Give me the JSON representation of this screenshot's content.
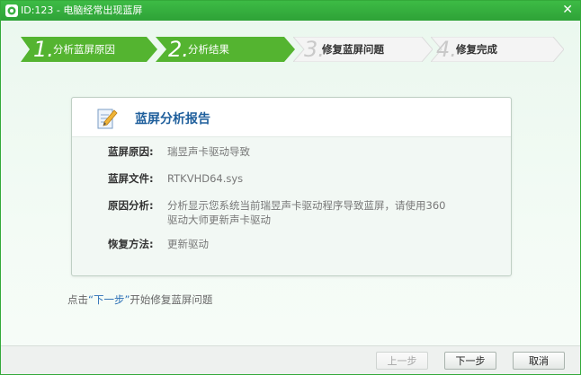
{
  "window": {
    "title": "ID:123 - 电脑经常出现蓝屏",
    "close_glyph": "✕",
    "icon": "app-logo-icon"
  },
  "steps": [
    {
      "num": "1.",
      "label": "分析蓝屏原因",
      "state": "active"
    },
    {
      "num": "2.",
      "label": "分析结果",
      "state": "active"
    },
    {
      "num": "3.",
      "label": "修复蓝屏问题",
      "state": "inactive"
    },
    {
      "num": "4.",
      "label": "修复完成",
      "state": "inactive"
    }
  ],
  "report": {
    "title": "蓝屏分析报告",
    "icon": "document-edit-icon",
    "rows": [
      {
        "key": "蓝屏原因:",
        "value": "瑞昱声卡驱动导致"
      },
      {
        "key": "蓝屏文件:",
        "value": "RTKVHD64.sys"
      },
      {
        "key": "原因分析:",
        "value": "分析显示您系统当前瑞昱声卡驱动程序导致蓝屏，请使用360驱动大师更新声卡驱动"
      },
      {
        "key": "恢复方法:",
        "value": "更新驱动"
      }
    ]
  },
  "hint": {
    "prefix": "点击",
    "highlight": "“下一步”",
    "suffix": "开始修复蓝屏问题"
  },
  "buttons": {
    "prev": "上一步",
    "next": "下一步",
    "cancel": "取消"
  },
  "colors": {
    "title_bar": "#34b23d",
    "step_active": "#54b430",
    "step_inactive": "#f4f4f4",
    "report_title": "#1f5f9c",
    "hint_highlight": "#2a6fb5"
  }
}
